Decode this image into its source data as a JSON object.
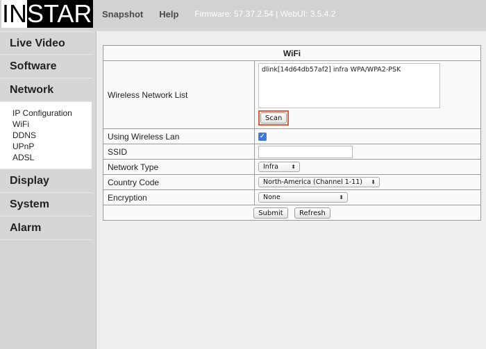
{
  "logo": {
    "part1": "IN",
    "part2": "STAR"
  },
  "topnav": {
    "snapshot": "Snapshot",
    "help": "Help",
    "firmware": "Firmware: 57.37.2.54 | WebUI: 3.5.4.2"
  },
  "sidebar": {
    "items": [
      "Live Video",
      "Software",
      "Network",
      "Display",
      "System",
      "Alarm"
    ],
    "network_sub": [
      "IP Configuration",
      "WiFi",
      "DDNS",
      "UPnP",
      "ADSL"
    ]
  },
  "wifi": {
    "title": "WiFi",
    "network_list_label": "Wireless Network List",
    "network_list_entry": "dlink[14d64db57af2] infra WPA/WPA2-PSK",
    "scan_label": "Scan",
    "using_wireless_label": "Using Wireless Lan",
    "using_wireless_checked": true,
    "ssid_label": "SSID",
    "ssid_value": "",
    "network_type_label": "Network Type",
    "network_type_value": "Infra",
    "country_code_label": "Country Code",
    "country_code_value": "North-America (Channel 1-11)",
    "encryption_label": "Encryption",
    "encryption_value": "None",
    "submit_label": "Submit",
    "refresh_label": "Refresh"
  },
  "colors": {
    "scan_highlight": "#e05a3c",
    "checkbox": "#3b78d8"
  },
  "icons": {
    "checkbox": "checkmark-icon",
    "select_arrow": "up-down-chevron-icon"
  }
}
